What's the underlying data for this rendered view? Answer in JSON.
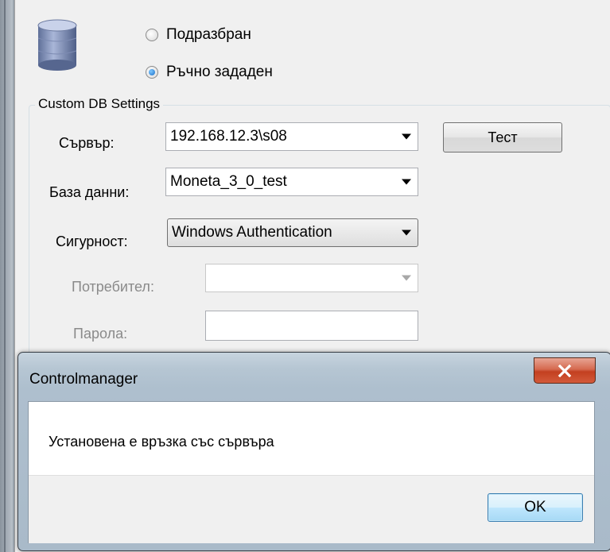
{
  "settings": {
    "radio_default_label": "Подразбран",
    "radio_manual_label": "Ръчно зададен",
    "group_label": "Custom DB Settings",
    "server_label": "Сървър:",
    "server_value": "192.168.12.3\\s08",
    "test_button": "Тест",
    "database_label": "База данни:",
    "database_value": "Moneta_3_0_test",
    "security_label": "Сигурност:",
    "security_value": "Windows Authentication",
    "user_label": "Потребител:",
    "user_value": "",
    "password_label": "Парола:",
    "password_value": ""
  },
  "dialog": {
    "title": "Controlmanager",
    "message": "Установена е връзка със сървъра",
    "ok_label": "OK",
    "close_label": "X"
  }
}
